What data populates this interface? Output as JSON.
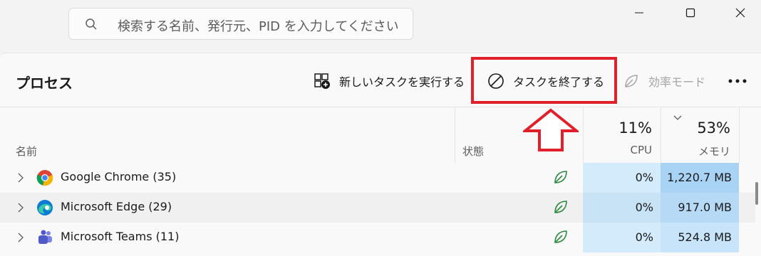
{
  "search": {
    "placeholder": "検索する名前、発行元、PID を入力してください"
  },
  "page": {
    "title": "プロセス"
  },
  "toolbar": {
    "new_task_label": "新しいタスクを実行する",
    "end_task_label": "タスクを終了する",
    "efficiency_label": "効率モード"
  },
  "columns": {
    "name": "名前",
    "status": "状態",
    "cpu_label": "CPU",
    "cpu_percent": "11%",
    "memory_label": "メモリ",
    "memory_percent": "53%"
  },
  "rows": [
    {
      "name": "Google Chrome (35)",
      "cpu": "0%",
      "memory": "1,220.7 MB",
      "icon": "chrome-icon"
    },
    {
      "name": "Microsoft Edge (29)",
      "cpu": "0%",
      "memory": "917.0 MB",
      "icon": "edge-icon"
    },
    {
      "name": "Microsoft Teams (11)",
      "cpu": "0%",
      "memory": "524.8 MB",
      "icon": "teams-icon"
    }
  ],
  "colors": {
    "highlight": "#e0202a",
    "cpu_cell": "#d3ebfb",
    "memory_cell_high": "#a9d3f5",
    "memory_cell": "#c7e4fa",
    "efficiency_leaf": "#2d8a3e"
  }
}
